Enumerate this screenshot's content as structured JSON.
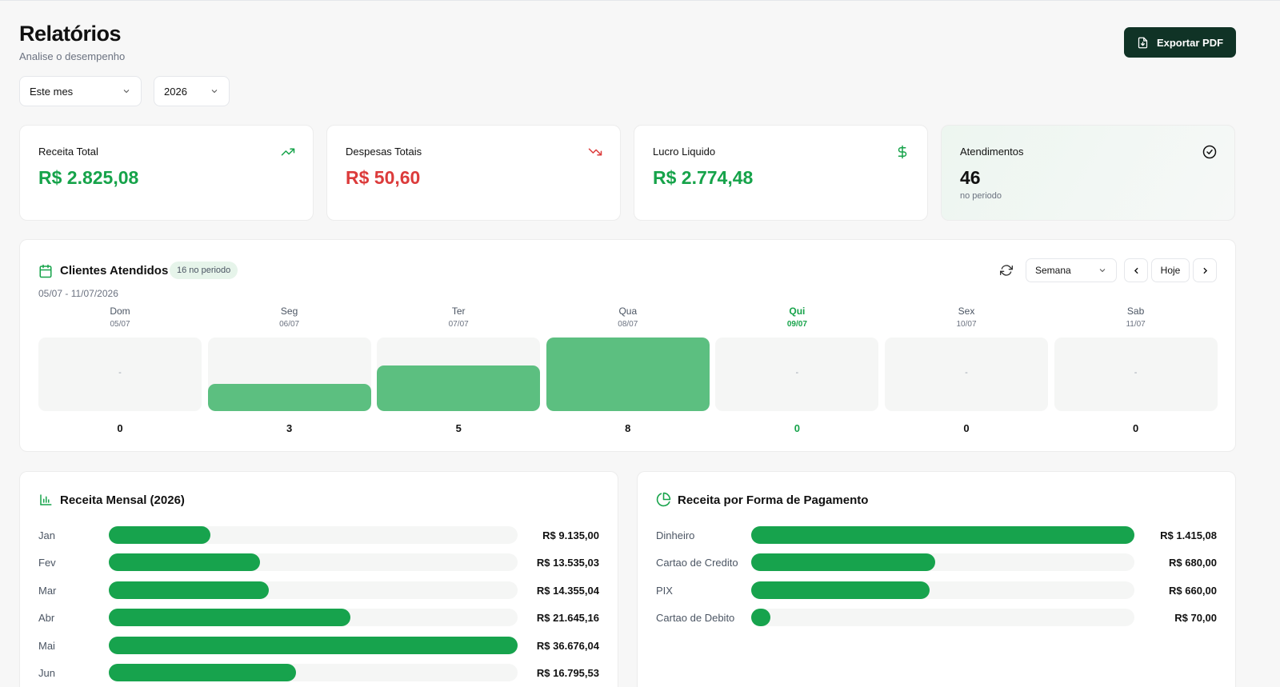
{
  "header": {
    "title": "Relatórios",
    "subtitle": "Analise o desempenho",
    "export_label": "Exportar PDF"
  },
  "filters": {
    "period": "Este mes",
    "year": "2026"
  },
  "stats": [
    {
      "label": "Receita Total",
      "value": "R$ 2.825,08",
      "icon": "trending-up-icon",
      "color": "#16a34a"
    },
    {
      "label": "Despesas Totais",
      "value": "R$ 50,60",
      "icon": "trending-down-icon",
      "color": "#dc3b3b"
    },
    {
      "label": "Lucro Liquido",
      "value": "R$ 2.774,48",
      "icon": "dollar-icon",
      "color": "#16a34a"
    },
    {
      "label": "Atendimentos",
      "value": "46",
      "sub": "no periodo",
      "icon": "check-circle-icon",
      "color": "#111111"
    }
  ],
  "clients": {
    "title": "Clientes Atendidos",
    "badge": "16 no periodo",
    "range": "05/07 - 11/07/2026",
    "view": "Semana",
    "today_label": "Hoje",
    "empty_marker": "-",
    "max": 8,
    "days": [
      {
        "name": "Dom",
        "date": "05/07",
        "count": 0
      },
      {
        "name": "Seg",
        "date": "06/07",
        "count": 3
      },
      {
        "name": "Ter",
        "date": "07/07",
        "count": 5
      },
      {
        "name": "Qua",
        "date": "08/07",
        "count": 8
      },
      {
        "name": "Qui",
        "date": "09/07",
        "count": 0,
        "today": true
      },
      {
        "name": "Sex",
        "date": "10/07",
        "count": 0
      },
      {
        "name": "Sab",
        "date": "11/07",
        "count": 0
      }
    ]
  },
  "monthly": {
    "title": "Receita Mensal (2026)",
    "max": 36676.04,
    "rows": [
      {
        "label": "Jan",
        "amount": 9135.0,
        "value": "R$ 9.135,00"
      },
      {
        "label": "Fev",
        "amount": 13535.03,
        "value": "R$ 13.535,03"
      },
      {
        "label": "Mar",
        "amount": 14355.04,
        "value": "R$ 14.355,04"
      },
      {
        "label": "Abr",
        "amount": 21645.16,
        "value": "R$ 21.645,16"
      },
      {
        "label": "Mai",
        "amount": 36676.04,
        "value": "R$ 36.676,04"
      },
      {
        "label": "Jun",
        "amount": 16795.53,
        "value": "R$ 16.795,53"
      }
    ]
  },
  "payment": {
    "title": "Receita por Forma de Pagamento",
    "max": 1415.08,
    "rows": [
      {
        "label": "Dinheiro",
        "amount": 1415.08,
        "value": "R$ 1.415,08"
      },
      {
        "label": "Cartao de Credito",
        "amount": 680.0,
        "value": "R$ 680,00"
      },
      {
        "label": "PIX",
        "amount": 660.0,
        "value": "R$ 660,00"
      },
      {
        "label": "Cartao de Debito",
        "amount": 70.0,
        "value": "R$ 70,00"
      }
    ]
  }
}
